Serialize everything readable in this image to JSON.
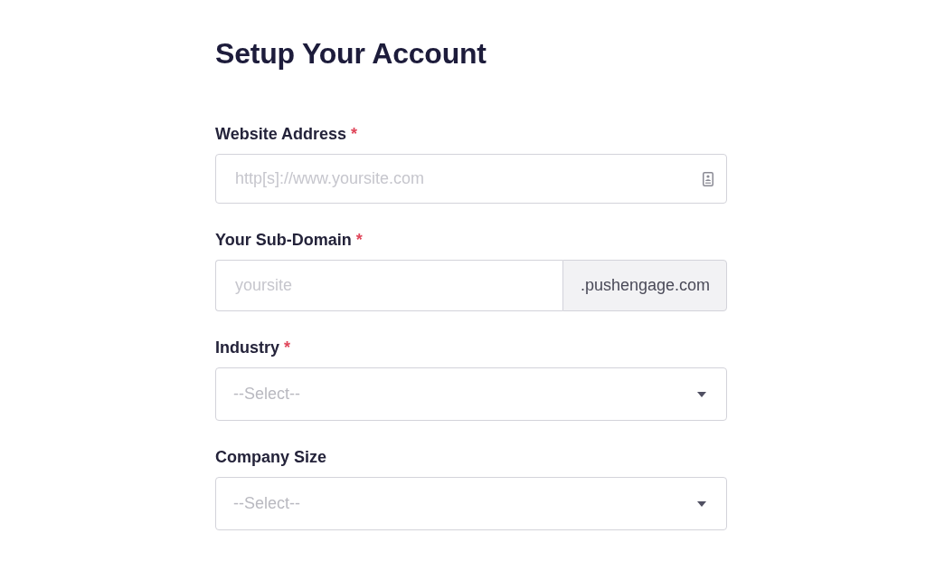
{
  "title": "Setup Your Account",
  "fields": [
    {
      "kind": "text",
      "label": "Website Address",
      "required_mark": "*",
      "placeholder": "http[s]://www.yoursite.com"
    },
    {
      "kind": "addon",
      "label": "Your Sub-Domain",
      "required_mark": "*",
      "placeholder": "yoursite",
      "suffix": ".pushengage.com"
    },
    {
      "kind": "select",
      "label": "Industry",
      "required_mark": "*",
      "placeholder": "--Select--"
    },
    {
      "kind": "select",
      "label": "Company Size",
      "placeholder": "--Select--"
    }
  ]
}
